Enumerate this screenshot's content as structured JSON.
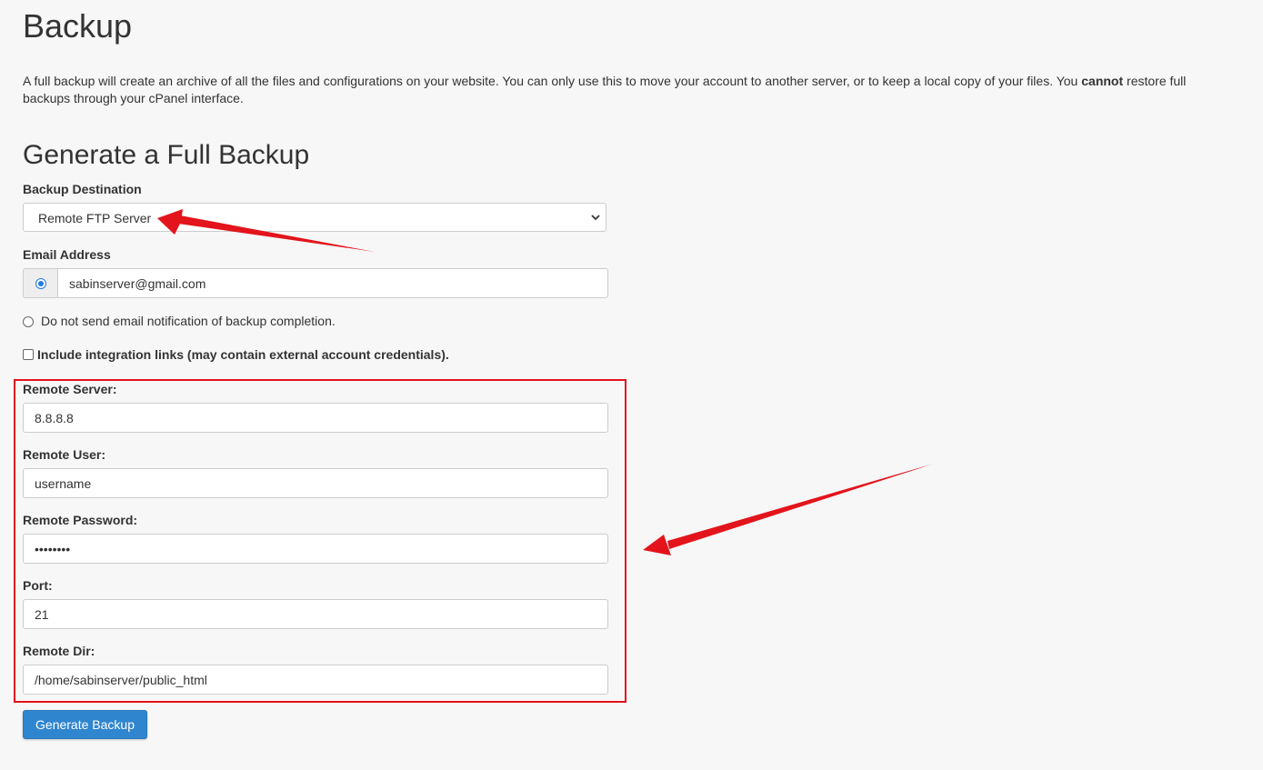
{
  "page": {
    "title": "Backup",
    "intro_text": "A full backup will create an archive of all the files and configurations on your website. You can only use this to move your account to another server, or to keep a local copy of your files. You ",
    "intro_bold": "cannot",
    "intro_text_end": " restore full backups through your cPanel interface."
  },
  "form": {
    "section_title": "Generate a Full Backup",
    "destination_label": "Backup Destination",
    "destination_value": "Remote FTP Server",
    "email_label": "Email Address",
    "email_value": "sabinserver@gmail.com",
    "no_email_label": "Do not send email notification of backup completion.",
    "integration_label": "Include integration links (may contain external account credentials).",
    "remote_server_label": "Remote Server:",
    "remote_server_value": "8.8.8.8",
    "remote_user_label": "Remote User:",
    "remote_user_value": "username",
    "remote_password_label": "Remote Password:",
    "remote_password_value": "••••••••",
    "port_label": "Port:",
    "port_value": "21",
    "remote_dir_label": "Remote Dir:",
    "remote_dir_value": "/home/sabinserver/public_html",
    "submit_label": "Generate Backup"
  },
  "colors": {
    "annotation_red": "#e3141b",
    "button_blue": "#2f86cf",
    "radio_blue": "#1e7be4"
  },
  "icons": {
    "select_arrow": "chevron-down-icon",
    "email_radio": "radio-selected-icon"
  }
}
